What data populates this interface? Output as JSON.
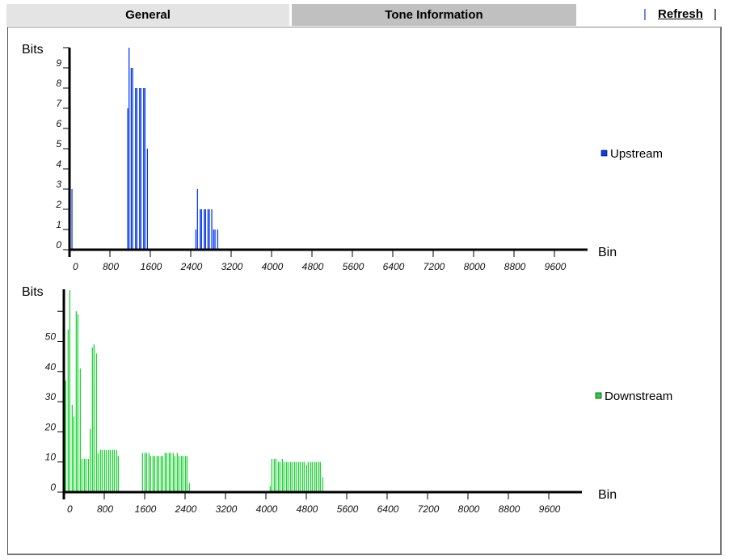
{
  "tabs": [
    {
      "label": "General",
      "active": false
    },
    {
      "label": "Tone Information",
      "active": true
    }
  ],
  "header": {
    "separator": "|",
    "refresh_label": "Refresh"
  },
  "colors": {
    "upstream": "#0a3cf0",
    "downstream": "#22d43a"
  },
  "chart_data": [
    {
      "type": "bar",
      "name": "upstream",
      "ylabel": "Bits",
      "xlabel": "Bin",
      "legend": "Upstream",
      "legend_position": "right",
      "xlim": [
        0,
        10240
      ],
      "ylim": [
        0,
        10
      ],
      "x_ticks": [
        0,
        800,
        1600,
        2400,
        3200,
        4000,
        4800,
        5600,
        6400,
        7200,
        8000,
        8800,
        9600
      ],
      "y_ticks": [
        0,
        1,
        2,
        3,
        4,
        5,
        6,
        7,
        8,
        9,
        10
      ],
      "y_tick_labels": [
        "0",
        "1",
        "2",
        "3",
        "4",
        "5",
        "6",
        "7",
        "8",
        "9",
        ""
      ],
      "x": [
        48,
        1152,
        1178,
        1221,
        1248,
        1307,
        1333,
        1387,
        1413,
        1467,
        1493,
        1541,
        2501,
        2533,
        2587,
        2613,
        2667,
        2693,
        2741,
        2768,
        2816,
        2853,
        2880,
        2933
      ],
      "values": [
        3,
        7,
        10,
        9,
        9,
        8,
        8,
        8,
        8,
        8,
        8,
        5,
        1,
        3,
        2,
        2,
        2,
        2,
        2,
        2,
        2,
        1,
        1,
        1
      ]
    },
    {
      "type": "bar",
      "name": "downstream",
      "ylabel": "Bits",
      "xlabel": "Bin",
      "legend": "Downstream",
      "legend_position": "right",
      "xlim": [
        0,
        10240
      ],
      "ylim": [
        0,
        67
      ],
      "x_ticks": [
        0,
        800,
        1600,
        2400,
        3200,
        4000,
        4800,
        5600,
        6400,
        7200,
        8000,
        8800,
        9600
      ],
      "y_ticks": [
        0,
        10,
        20,
        30,
        40,
        50,
        60
      ],
      "y_tick_labels": [
        "0",
        "10",
        "20",
        "30",
        "40",
        "50",
        ""
      ],
      "x": [
        37,
        85,
        117,
        165,
        197,
        245,
        277,
        325,
        357,
        405,
        437,
        485,
        523,
        565,
        597,
        645,
        677,
        725,
        757,
        805,
        837,
        885,
        917,
        965,
        997,
        1045,
        1077,
        1557,
        1605,
        1637,
        1685,
        1717,
        1765,
        1797,
        1845,
        1877,
        1925,
        1957,
        2005,
        2037,
        2085,
        2117,
        2165,
        2197,
        2245,
        2277,
        2325,
        2357,
        2405,
        2437,
        2485,
        4085,
        4117,
        4165,
        4197,
        4245,
        4277,
        4325,
        4357,
        4405,
        4437,
        4485,
        4517,
        4565,
        4597,
        4645,
        4677,
        4725,
        4757,
        4805,
        4837,
        4885,
        4917,
        4965,
        4997,
        5045,
        5077,
        5125
      ],
      "values": [
        37,
        54,
        67,
        29,
        25,
        60,
        59,
        41,
        11,
        11,
        11,
        11,
        21,
        48,
        49,
        46,
        13,
        14,
        14,
        14,
        14,
        14,
        14,
        14,
        14,
        14,
        12,
        13,
        13,
        13,
        13,
        12,
        12,
        12,
        12,
        12,
        12,
        12,
        13,
        13,
        13,
        13,
        13,
        12,
        13,
        12,
        12,
        12,
        12,
        12,
        3,
        2,
        11,
        11,
        11,
        10,
        10,
        11,
        10,
        10,
        10,
        10,
        10,
        10,
        10,
        10,
        10,
        10,
        10,
        9,
        10,
        10,
        10,
        10,
        10,
        10,
        10,
        5
      ]
    }
  ]
}
